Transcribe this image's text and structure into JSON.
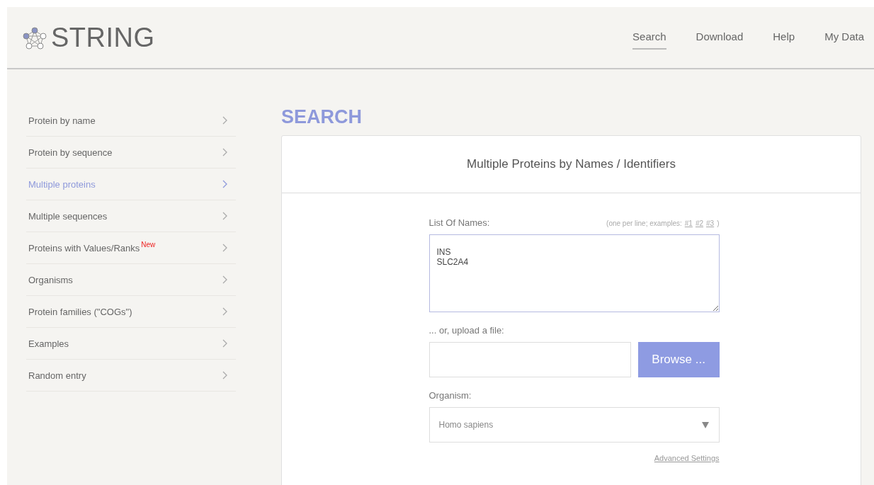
{
  "header": {
    "logo_text": "STRING",
    "nav": [
      {
        "label": "Search",
        "selected": true
      },
      {
        "label": "Download",
        "selected": false
      },
      {
        "label": "Help",
        "selected": false
      },
      {
        "label": "My Data",
        "selected": false
      }
    ]
  },
  "sidebar": {
    "items": [
      {
        "label": "Protein by name",
        "selected": false
      },
      {
        "label": "Protein by sequence",
        "selected": false
      },
      {
        "label": "Multiple proteins",
        "selected": true
      },
      {
        "label": "Multiple sequences",
        "selected": false
      },
      {
        "label": "Proteins with Values/Ranks",
        "badge": "New",
        "selected": false
      },
      {
        "label": "Organisms",
        "selected": false
      },
      {
        "label": "Protein families (\"COGs\")",
        "selected": false
      },
      {
        "label": "Examples",
        "selected": false
      },
      {
        "label": "Random entry",
        "selected": false
      }
    ]
  },
  "page_title": "SEARCH",
  "card": {
    "title": "Multiple Proteins by Names / Identifiers",
    "list_label": "List Of Names:",
    "list_hint": "(one per line; examples:",
    "example_links": [
      "#1",
      "#2",
      "#3"
    ],
    "list_hint_end": ")",
    "list_value": "INS\nSLC2A4\n",
    "upload_label": "... or, upload a file:",
    "browse_button": "Browse ...",
    "organism_label": "Organism:",
    "organism_value": "Homo sapiens",
    "advanced_link": "Advanced Settings"
  }
}
